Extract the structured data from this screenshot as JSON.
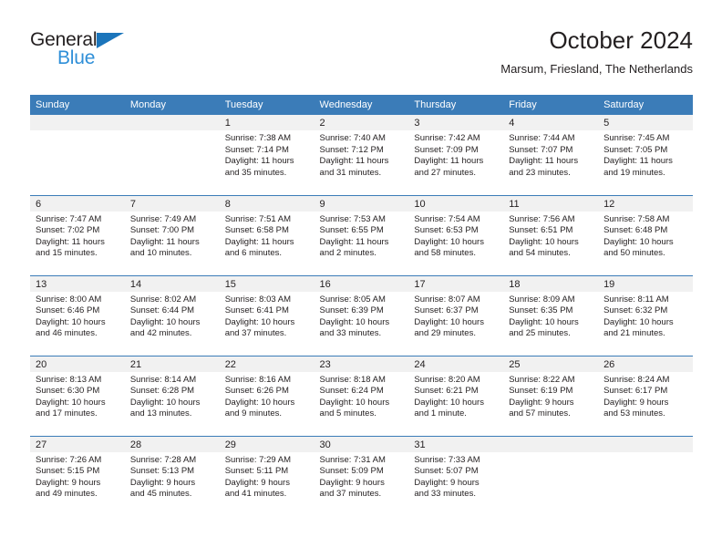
{
  "brand": {
    "name_top": "General",
    "name_bottom": "Blue",
    "accent_color": "#1b75bb",
    "accent_color_light": "#2f8fd8"
  },
  "header": {
    "title": "October 2024",
    "location": "Marsum, Friesland, The Netherlands"
  },
  "theme": {
    "header_bar_color": "#3b7cb8",
    "daynum_band_color": "#f1f1f1",
    "text_color": "#231f20"
  },
  "calendar": {
    "day_headers": [
      "Sunday",
      "Monday",
      "Tuesday",
      "Wednesday",
      "Thursday",
      "Friday",
      "Saturday"
    ],
    "weeks": [
      [
        {
          "day": "",
          "sunrise": "",
          "sunset": "",
          "daylight_line1": "",
          "daylight_line2": ""
        },
        {
          "day": "",
          "sunrise": "",
          "sunset": "",
          "daylight_line1": "",
          "daylight_line2": ""
        },
        {
          "day": "1",
          "sunrise": "Sunrise: 7:38 AM",
          "sunset": "Sunset: 7:14 PM",
          "daylight_line1": "Daylight: 11 hours",
          "daylight_line2": "and 35 minutes."
        },
        {
          "day": "2",
          "sunrise": "Sunrise: 7:40 AM",
          "sunset": "Sunset: 7:12 PM",
          "daylight_line1": "Daylight: 11 hours",
          "daylight_line2": "and 31 minutes."
        },
        {
          "day": "3",
          "sunrise": "Sunrise: 7:42 AM",
          "sunset": "Sunset: 7:09 PM",
          "daylight_line1": "Daylight: 11 hours",
          "daylight_line2": "and 27 minutes."
        },
        {
          "day": "4",
          "sunrise": "Sunrise: 7:44 AM",
          "sunset": "Sunset: 7:07 PM",
          "daylight_line1": "Daylight: 11 hours",
          "daylight_line2": "and 23 minutes."
        },
        {
          "day": "5",
          "sunrise": "Sunrise: 7:45 AM",
          "sunset": "Sunset: 7:05 PM",
          "daylight_line1": "Daylight: 11 hours",
          "daylight_line2": "and 19 minutes."
        }
      ],
      [
        {
          "day": "6",
          "sunrise": "Sunrise: 7:47 AM",
          "sunset": "Sunset: 7:02 PM",
          "daylight_line1": "Daylight: 11 hours",
          "daylight_line2": "and 15 minutes."
        },
        {
          "day": "7",
          "sunrise": "Sunrise: 7:49 AM",
          "sunset": "Sunset: 7:00 PM",
          "daylight_line1": "Daylight: 11 hours",
          "daylight_line2": "and 10 minutes."
        },
        {
          "day": "8",
          "sunrise": "Sunrise: 7:51 AM",
          "sunset": "Sunset: 6:58 PM",
          "daylight_line1": "Daylight: 11 hours",
          "daylight_line2": "and 6 minutes."
        },
        {
          "day": "9",
          "sunrise": "Sunrise: 7:53 AM",
          "sunset": "Sunset: 6:55 PM",
          "daylight_line1": "Daylight: 11 hours",
          "daylight_line2": "and 2 minutes."
        },
        {
          "day": "10",
          "sunrise": "Sunrise: 7:54 AM",
          "sunset": "Sunset: 6:53 PM",
          "daylight_line1": "Daylight: 10 hours",
          "daylight_line2": "and 58 minutes."
        },
        {
          "day": "11",
          "sunrise": "Sunrise: 7:56 AM",
          "sunset": "Sunset: 6:51 PM",
          "daylight_line1": "Daylight: 10 hours",
          "daylight_line2": "and 54 minutes."
        },
        {
          "day": "12",
          "sunrise": "Sunrise: 7:58 AM",
          "sunset": "Sunset: 6:48 PM",
          "daylight_line1": "Daylight: 10 hours",
          "daylight_line2": "and 50 minutes."
        }
      ],
      [
        {
          "day": "13",
          "sunrise": "Sunrise: 8:00 AM",
          "sunset": "Sunset: 6:46 PM",
          "daylight_line1": "Daylight: 10 hours",
          "daylight_line2": "and 46 minutes."
        },
        {
          "day": "14",
          "sunrise": "Sunrise: 8:02 AM",
          "sunset": "Sunset: 6:44 PM",
          "daylight_line1": "Daylight: 10 hours",
          "daylight_line2": "and 42 minutes."
        },
        {
          "day": "15",
          "sunrise": "Sunrise: 8:03 AM",
          "sunset": "Sunset: 6:41 PM",
          "daylight_line1": "Daylight: 10 hours",
          "daylight_line2": "and 37 minutes."
        },
        {
          "day": "16",
          "sunrise": "Sunrise: 8:05 AM",
          "sunset": "Sunset: 6:39 PM",
          "daylight_line1": "Daylight: 10 hours",
          "daylight_line2": "and 33 minutes."
        },
        {
          "day": "17",
          "sunrise": "Sunrise: 8:07 AM",
          "sunset": "Sunset: 6:37 PM",
          "daylight_line1": "Daylight: 10 hours",
          "daylight_line2": "and 29 minutes."
        },
        {
          "day": "18",
          "sunrise": "Sunrise: 8:09 AM",
          "sunset": "Sunset: 6:35 PM",
          "daylight_line1": "Daylight: 10 hours",
          "daylight_line2": "and 25 minutes."
        },
        {
          "day": "19",
          "sunrise": "Sunrise: 8:11 AM",
          "sunset": "Sunset: 6:32 PM",
          "daylight_line1": "Daylight: 10 hours",
          "daylight_line2": "and 21 minutes."
        }
      ],
      [
        {
          "day": "20",
          "sunrise": "Sunrise: 8:13 AM",
          "sunset": "Sunset: 6:30 PM",
          "daylight_line1": "Daylight: 10 hours",
          "daylight_line2": "and 17 minutes."
        },
        {
          "day": "21",
          "sunrise": "Sunrise: 8:14 AM",
          "sunset": "Sunset: 6:28 PM",
          "daylight_line1": "Daylight: 10 hours",
          "daylight_line2": "and 13 minutes."
        },
        {
          "day": "22",
          "sunrise": "Sunrise: 8:16 AM",
          "sunset": "Sunset: 6:26 PM",
          "daylight_line1": "Daylight: 10 hours",
          "daylight_line2": "and 9 minutes."
        },
        {
          "day": "23",
          "sunrise": "Sunrise: 8:18 AM",
          "sunset": "Sunset: 6:24 PM",
          "daylight_line1": "Daylight: 10 hours",
          "daylight_line2": "and 5 minutes."
        },
        {
          "day": "24",
          "sunrise": "Sunrise: 8:20 AM",
          "sunset": "Sunset: 6:21 PM",
          "daylight_line1": "Daylight: 10 hours",
          "daylight_line2": "and 1 minute."
        },
        {
          "day": "25",
          "sunrise": "Sunrise: 8:22 AM",
          "sunset": "Sunset: 6:19 PM",
          "daylight_line1": "Daylight: 9 hours",
          "daylight_line2": "and 57 minutes."
        },
        {
          "day": "26",
          "sunrise": "Sunrise: 8:24 AM",
          "sunset": "Sunset: 6:17 PM",
          "daylight_line1": "Daylight: 9 hours",
          "daylight_line2": "and 53 minutes."
        }
      ],
      [
        {
          "day": "27",
          "sunrise": "Sunrise: 7:26 AM",
          "sunset": "Sunset: 5:15 PM",
          "daylight_line1": "Daylight: 9 hours",
          "daylight_line2": "and 49 minutes."
        },
        {
          "day": "28",
          "sunrise": "Sunrise: 7:28 AM",
          "sunset": "Sunset: 5:13 PM",
          "daylight_line1": "Daylight: 9 hours",
          "daylight_line2": "and 45 minutes."
        },
        {
          "day": "29",
          "sunrise": "Sunrise: 7:29 AM",
          "sunset": "Sunset: 5:11 PM",
          "daylight_line1": "Daylight: 9 hours",
          "daylight_line2": "and 41 minutes."
        },
        {
          "day": "30",
          "sunrise": "Sunrise: 7:31 AM",
          "sunset": "Sunset: 5:09 PM",
          "daylight_line1": "Daylight: 9 hours",
          "daylight_line2": "and 37 minutes."
        },
        {
          "day": "31",
          "sunrise": "Sunrise: 7:33 AM",
          "sunset": "Sunset: 5:07 PM",
          "daylight_line1": "Daylight: 9 hours",
          "daylight_line2": "and 33 minutes."
        },
        {
          "day": "",
          "sunrise": "",
          "sunset": "",
          "daylight_line1": "",
          "daylight_line2": ""
        },
        {
          "day": "",
          "sunrise": "",
          "sunset": "",
          "daylight_line1": "",
          "daylight_line2": ""
        }
      ]
    ]
  }
}
